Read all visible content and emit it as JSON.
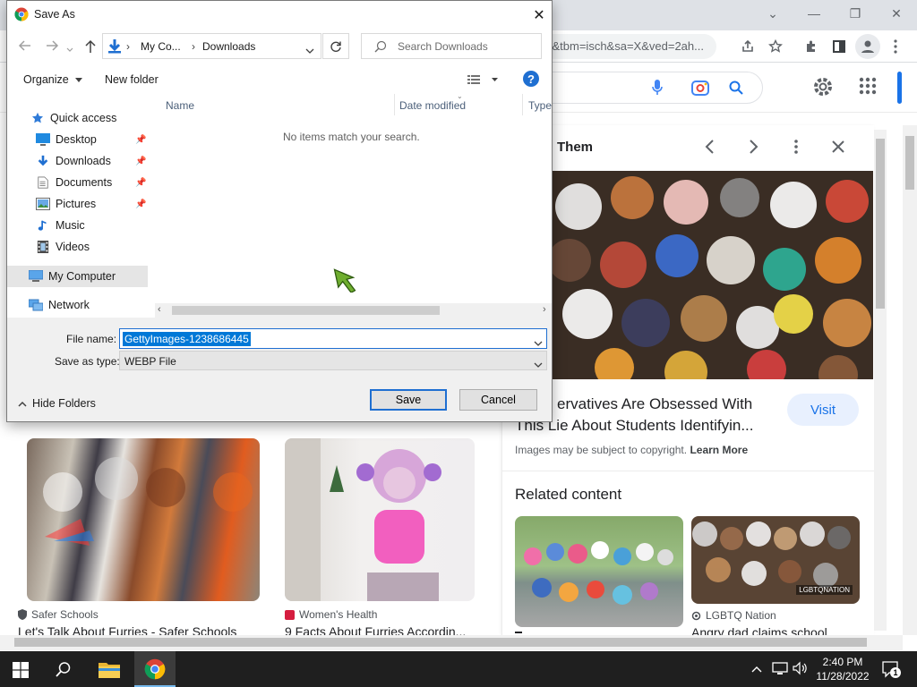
{
  "browser": {
    "url_text": "s&tbm=isch&sa=X&ved=2ah...",
    "minimize_glyph": "—",
    "restore_glyph": "❐",
    "close_glyph": "✕",
    "chevron_glyph": "⌄"
  },
  "results": [
    {
      "source": "Safer Schools",
      "title": "Let's Talk About Furries - Safer Schools"
    },
    {
      "source": "Women's Health",
      "title": "9 Facts About Furries Accordin..."
    }
  ],
  "preview": {
    "header_partial": "Them",
    "title_line1": "ervatives Are Obsessed With",
    "title_line2": "This Lie About Students Identifyin...",
    "visit_label": "Visit",
    "copyright_text": "Images may be subject to copyright.",
    "learn_more": "Learn More",
    "related_heading": "Related content",
    "related": [
      {
        "source": "",
        "title": ""
      },
      {
        "source": "LGBTQ Nation",
        "title": "Angry dad claims school",
        "badge": "LGBTQNATION"
      }
    ]
  },
  "dialog": {
    "title": "Save As",
    "close_glyph": "✕",
    "breadcrumb": [
      "My Co...",
      "Downloads"
    ],
    "search_placeholder": "Search Downloads",
    "organize_label": "Organize",
    "new_folder_label": "New folder",
    "columns": [
      "Name",
      "Date modified",
      "Type"
    ],
    "empty_message": "No items match your search.",
    "nav": {
      "quick_access": "Quick access",
      "items": [
        "Desktop",
        "Downloads",
        "Documents",
        "Pictures",
        "Music",
        "Videos"
      ],
      "my_computer": "My Computer",
      "network": "Network"
    },
    "file_name_label": "File name:",
    "file_name_value": "GettyImages-1238686445",
    "save_type_label": "Save as type:",
    "save_type_value": "WEBP File",
    "hide_folders_label": "Hide Folders",
    "save_label": "Save",
    "cancel_label": "Cancel"
  },
  "taskbar": {
    "time": "2:40 PM",
    "date": "11/28/2022",
    "notification_count": "1"
  },
  "colors": {
    "accent": "#1a73e8",
    "selection": "#0078d7",
    "taskbar": "#1f1f1f"
  }
}
